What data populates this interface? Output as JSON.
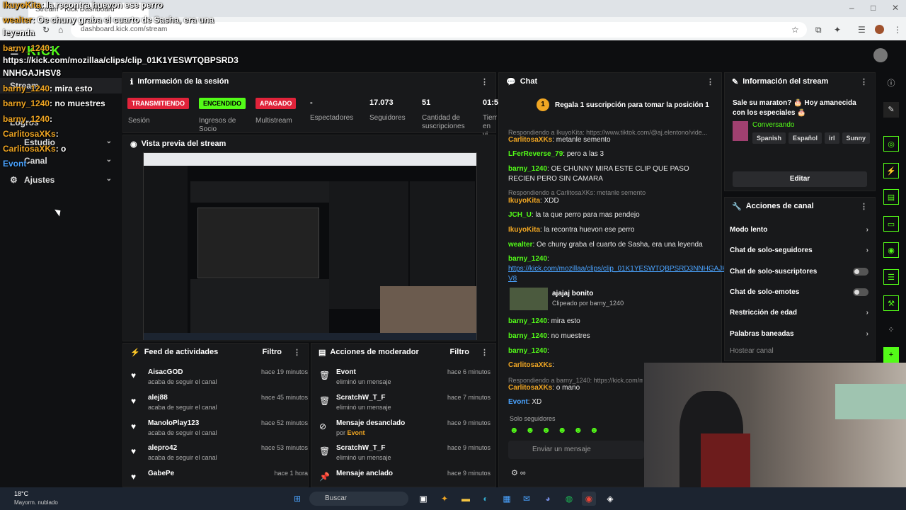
{
  "browser": {
    "tab_title": "Stream - Kick Dashboard",
    "url": "dashboard.kick.com/stream"
  },
  "overlay_chat": {
    "lines": [
      {
        "user": "IkuyoKita",
        "text": ": la recontra huevon ese perro"
      },
      {
        "user": "wealter",
        "text": ": Oe chuny graba el cuarto de Sasha, era una"
      },
      {
        "user": "",
        "text": "leyenda"
      },
      {
        "user": "barny_1240",
        "text": ":"
      },
      {
        "user": "",
        "text": "https://kick.com/mozillaa/clips/clip_01K1YESWTQBPSRD3"
      },
      {
        "user": "",
        "text": "NNHGAJHSV8"
      },
      {
        "user": "barny_1240",
        "text": ": mira esto"
      },
      {
        "user": "barny_1240",
        "text": ": no muestres"
      },
      {
        "user": "barny_1240",
        "text": ":"
      },
      {
        "user": "CarlitosaXKs",
        "text": ":"
      },
      {
        "user": "CarlitosaXKs",
        "text": ": o"
      },
      {
        "user": "Evont",
        "text": ""
      }
    ]
  },
  "sidebar": {
    "items": [
      {
        "label": "Stream"
      },
      {
        "label": "Logros"
      },
      {
        "label": "Estudio"
      },
      {
        "label": "Canal"
      },
      {
        "label": "Ajustes"
      }
    ]
  },
  "session": {
    "title": "Información de la sesión",
    "badges": [
      {
        "label": "TRANSMITIENDO",
        "caption": "Sesión",
        "color": "#e0233a"
      },
      {
        "label": "ENCENDIDO",
        "caption": "Ingresos de Socio",
        "color": "#53fc18"
      },
      {
        "label": "APAGADO",
        "caption": "Multistream",
        "color": "#e0233a"
      }
    ],
    "stats": [
      {
        "value": "-",
        "label": "Espectadores"
      },
      {
        "value": "17.073",
        "label": "Seguidores"
      },
      {
        "value": "51",
        "label": "Cantidad de suscripciones"
      },
      {
        "value": "01:5",
        "label": "Tiem en vi"
      }
    ]
  },
  "preview": {
    "title": "Vista previa del stream"
  },
  "feed": {
    "title": "Feed de actividades",
    "filter": "Filtro",
    "rows": [
      {
        "name": "AisacGOD",
        "action": "acaba de seguir el canal",
        "time": "hace 19 minutos"
      },
      {
        "name": "alej88",
        "action": "acaba de seguir el canal",
        "time": "hace 45 minutos"
      },
      {
        "name": "ManoloPlay123",
        "action": "acaba de seguir el canal",
        "time": "hace 52 minutos"
      },
      {
        "name": "alepro42",
        "action": "acaba de seguir el canal",
        "time": "hace 53 minutos"
      },
      {
        "name": "GabePe",
        "action": "",
        "time": "hace 1 hora"
      }
    ]
  },
  "mod": {
    "title": "Acciones de moderador",
    "filter": "Filtro",
    "rows": [
      {
        "name": "Evont",
        "action": "eliminó un mensaje",
        "by": "",
        "time": "hace 6 minutos"
      },
      {
        "name": "ScratchW_T_F",
        "action": "eliminó un mensaje",
        "by": "",
        "time": "hace 7 minutos"
      },
      {
        "name": "Mensaje desanclado",
        "action": "por",
        "by": "Evont",
        "time": "hace 9 minutos"
      },
      {
        "name": "ScratchW_T_F",
        "action": "eliminó un mensaje",
        "by": "",
        "time": "hace 9 minutos"
      },
      {
        "name": "Mensaje anclado",
        "action": "",
        "by": "",
        "time": "hace 9 minutos"
      }
    ]
  },
  "chat": {
    "title": "Chat",
    "pinned": "Regala 1 suscripción para tomar la posición 1",
    "pinned_rank": "1",
    "messages": [
      {
        "reply": "Respondiendo a IkuyoKita: https://www.tiktok.com/@aj.elentono/vide...",
        "user": "CarlitosaXKs",
        "text": ": metanle semento",
        "color": "orange"
      },
      {
        "reply": "",
        "user": "LFerReverse_79",
        "text": ": pero a las 3",
        "color": "green"
      },
      {
        "reply": "",
        "user": "barny_1240",
        "text": ": OE CHUNNY MIRA ESTE CLIP QUE PASO RECIEN PERO SIN CAMARA",
        "color": "green"
      },
      {
        "reply": "Respondiendo a CarlitosaXKs: metanle semento",
        "user": "IkuyoKita",
        "text": ": XDD",
        "color": "orange"
      },
      {
        "reply": "",
        "user": "JCH_U",
        "text": ": la ta que perro para mas pendejo",
        "color": "green"
      },
      {
        "reply": "",
        "user": "IkuyoKita",
        "text": ": la recontra huevon ese perro",
        "color": "orange"
      },
      {
        "reply": "",
        "user": "wealter",
        "text": ": Oe chuny graba el cuarto de Sasha, era una leyenda",
        "color": "green"
      },
      {
        "reply": "",
        "user": "barny_1240",
        "text": ":",
        "color": "green"
      },
      {
        "reply": "",
        "user": "",
        "text": "https://kick.com/mozillaa/clips/clip_01K1YESWTQBPSRD3NNHGAJHS V8",
        "color": "blue"
      },
      {
        "reply": "",
        "user": "",
        "text": "",
        "color": "green"
      },
      {
        "reply": "",
        "user": "barny_1240",
        "text": ": mira esto",
        "color": "green"
      },
      {
        "reply": "",
        "user": "barny_1240",
        "text": ": no muestres",
        "color": "green"
      },
      {
        "reply": "",
        "user": "barny_1240",
        "text": ":",
        "color": "green"
      },
      {
        "reply": "",
        "user": "CarlitosaXKs",
        "text": ":",
        "color": "orange"
      },
      {
        "reply": "Respondiendo a barny_1240: https://kick.com/m",
        "user": "CarlitosaXKs",
        "text": ": o mano",
        "color": "orange"
      },
      {
        "reply": "",
        "user": "Evont",
        "text": ": XD",
        "color": "blue"
      }
    ],
    "clip_title": "ajajaj bonito",
    "clip_by": "Clipeado por barny_1240",
    "mode": "Solo seguidores",
    "input_placeholder": "Enviar un mensaje"
  },
  "stream_info": {
    "title": "Información del stream",
    "stream_title": "Sale su maraton? 🎂 Hoy amanecida con los especiales 🎂",
    "category": "Conversando",
    "tags": [
      "Spanish",
      "Español",
      "irl",
      "Sunny"
    ],
    "edit": "Editar"
  },
  "channel_actions": {
    "title": "Acciones de canal",
    "items": [
      {
        "label": "Modo lento",
        "kind": "chevron"
      },
      {
        "label": "Chat de solo-seguidores",
        "kind": "chevron"
      },
      {
        "label": "Chat de solo-suscriptores",
        "kind": "toggle"
      },
      {
        "label": "Chat de solo-emotes",
        "kind": "toggle"
      },
      {
        "label": "Restricción de edad",
        "kind": "chevron"
      },
      {
        "label": "Palabras baneadas",
        "kind": "chevron"
      },
      {
        "label": "Hostear canal",
        "kind": "none"
      }
    ]
  },
  "taskbar": {
    "weather_temp": "18°C",
    "weather_desc": "Mayorm. nublado",
    "search": "Buscar"
  },
  "colors": {
    "accent": "#53fc18",
    "live": "#e0233a",
    "bg": "#0d0e10",
    "panel": "#18191b"
  }
}
